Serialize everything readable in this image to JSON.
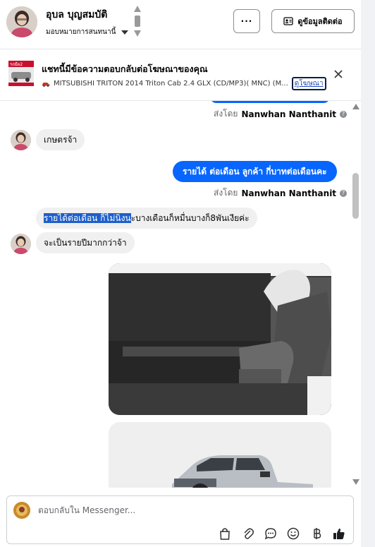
{
  "header": {
    "name": "อุบล บุญสมบัติ",
    "assignee": "มอบหมายการสนทนานี้",
    "more_label": "···",
    "contact_button": "ดูข้อมูลติดต่อ"
  },
  "ad_banner": {
    "title": "แชทนี้มีข้อความตอบกลับต่อโฆษณาของคุณ",
    "product": "MITSUBISHI TRITON 2014 Triton Cab 2.4 GLX (CD/MP3)( MNC) (M...",
    "link": "ดูโฆษณา",
    "thumb_text": "รถมือ2"
  },
  "messages": {
    "sent_by_prefix": "ส่งโดย",
    "sender": "Nanwhan Nanthanit",
    "incoming_1": "เกษตรจ้า",
    "outgoing_1": "รายได้ ต่อเดือน  ลูกค้า กี่บาทต่อเดือนคะ",
    "incoming_2_selected": "รายได้ต่อเดือน ก็ไม่นิ่งน",
    "incoming_2_rest": "ะบางเดือนก็หมื่นบางก็8พันเงียค่ะ",
    "incoming_3": "จะเป็นรายปีมากกว่าจ้า"
  },
  "composer": {
    "placeholder": "ตอบกลับใน Messenger..."
  },
  "colors": {
    "accent": "#0866ff",
    "incoming_bubble": "#f0f0f0",
    "selection": "#1e5fc9"
  },
  "icons": [
    "shopping-bag-icon",
    "paperclip-icon",
    "quick-reply-icon",
    "emoji-icon",
    "baht-icon",
    "thumbs-up-icon",
    "close-icon",
    "id-card-icon"
  ]
}
